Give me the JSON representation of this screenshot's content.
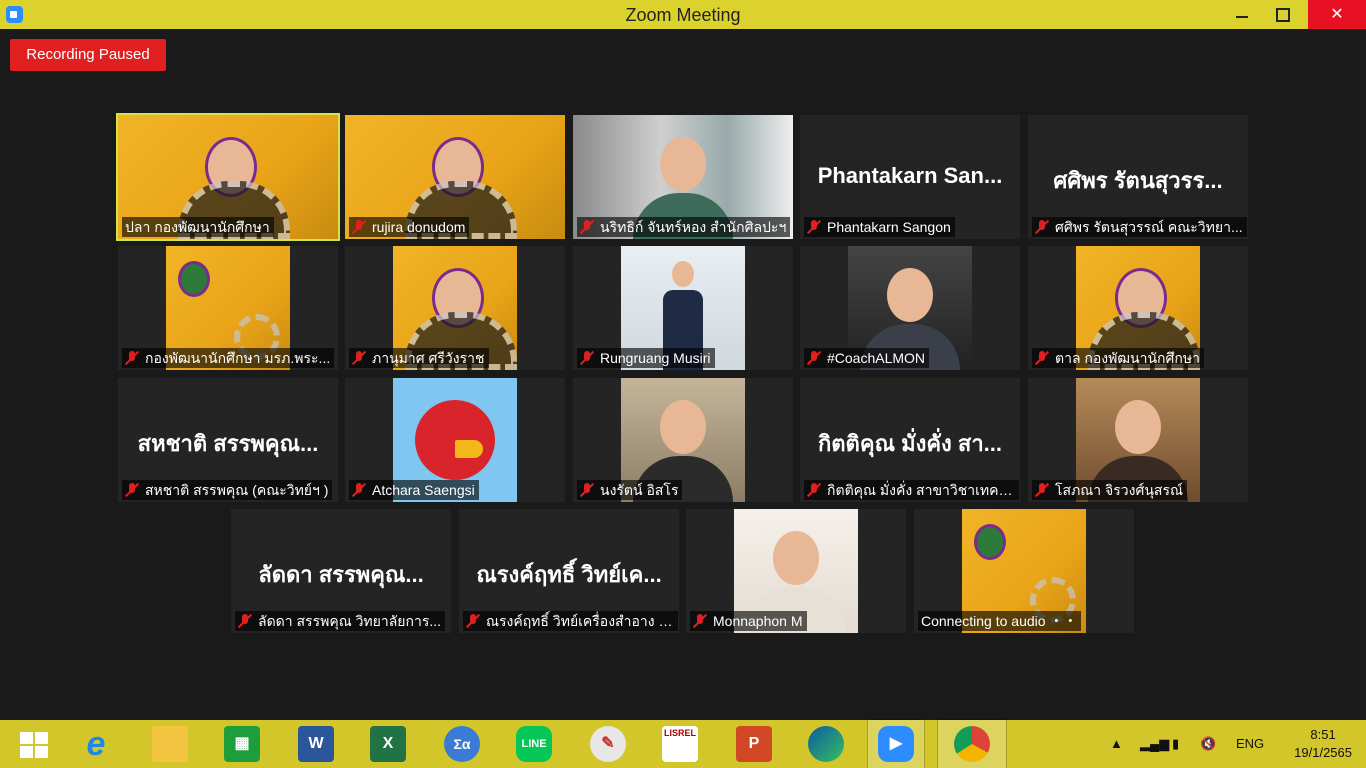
{
  "window": {
    "title": "Zoom Meeting"
  },
  "recording": {
    "label": "Recording Paused"
  },
  "participants": [
    {
      "label": "ปลา กองพัฒนานักศึกษา",
      "big": "",
      "muted": false
    },
    {
      "label": "rujira donudom",
      "big": "",
      "muted": true
    },
    {
      "label": "นริทธิก์ จันทร์หอง สำนักศิลปะฯ",
      "big": "",
      "muted": true
    },
    {
      "label": "Phantakarn Sangon",
      "big": "Phantakarn San...",
      "muted": true
    },
    {
      "label": "ศศิพร รัตนสุวรรณ์ คณะวิทยา...",
      "big": "ศศิพร รัตนสุวรร...",
      "muted": true
    },
    {
      "label": "กองพัฒนานักศึกษา มรภ.พระ...",
      "big": "",
      "muted": true
    },
    {
      "label": "ภานุมาศ ศรีวังราช",
      "big": "",
      "muted": true
    },
    {
      "label": "Rungruang Musiri",
      "big": "",
      "muted": true
    },
    {
      "label": "#CoachALMON",
      "big": "",
      "muted": true
    },
    {
      "label": "ตาล กองพัฒนานักศึกษา",
      "big": "",
      "muted": true
    },
    {
      "label": "สหชาติ สรรพคุณ (คณะวิทย์ฯ )",
      "big": "สหชาติ สรรพคุณ...",
      "muted": true
    },
    {
      "label": "Atchara Saengsi",
      "big": "",
      "muted": true
    },
    {
      "label": "นงรัตน์ อิสโร",
      "big": "",
      "muted": true
    },
    {
      "label": "กิตติคุณ มั่งคั่ง สาขาวิชาเทคโ...",
      "big": "กิตติคุณ มั่งคั่ง สา...",
      "muted": true
    },
    {
      "label": "โสภณา จิรวงศ์นุสรณ์",
      "big": "",
      "muted": true
    },
    {
      "label": "ลัดดา สรรพคุณ วิทยาลัยการ...",
      "big": "ลัดดา สรรพคุณ...",
      "muted": true
    },
    {
      "label": "ณรงค์ฤทธิ์ วิทย์เครื่องสำอาง P...",
      "big": "ณรงค์ฤทธิ์ วิทย์เค...",
      "muted": true
    },
    {
      "label": "Monnaphon M",
      "big": "",
      "muted": true
    },
    {
      "label": "Connecting to audio ・・",
      "big": "",
      "muted": false
    }
  ],
  "taskbar": {
    "apps": [
      "Internet Explorer",
      "File Explorer",
      "Store",
      "W",
      "X",
      "Σα",
      "LINE",
      "Paint",
      "LISREL",
      "P",
      "Edge",
      "Zoom",
      "Chrome"
    ],
    "tray": {
      "language": "ENG",
      "time": "8:51",
      "date": "19/1/2565"
    }
  }
}
